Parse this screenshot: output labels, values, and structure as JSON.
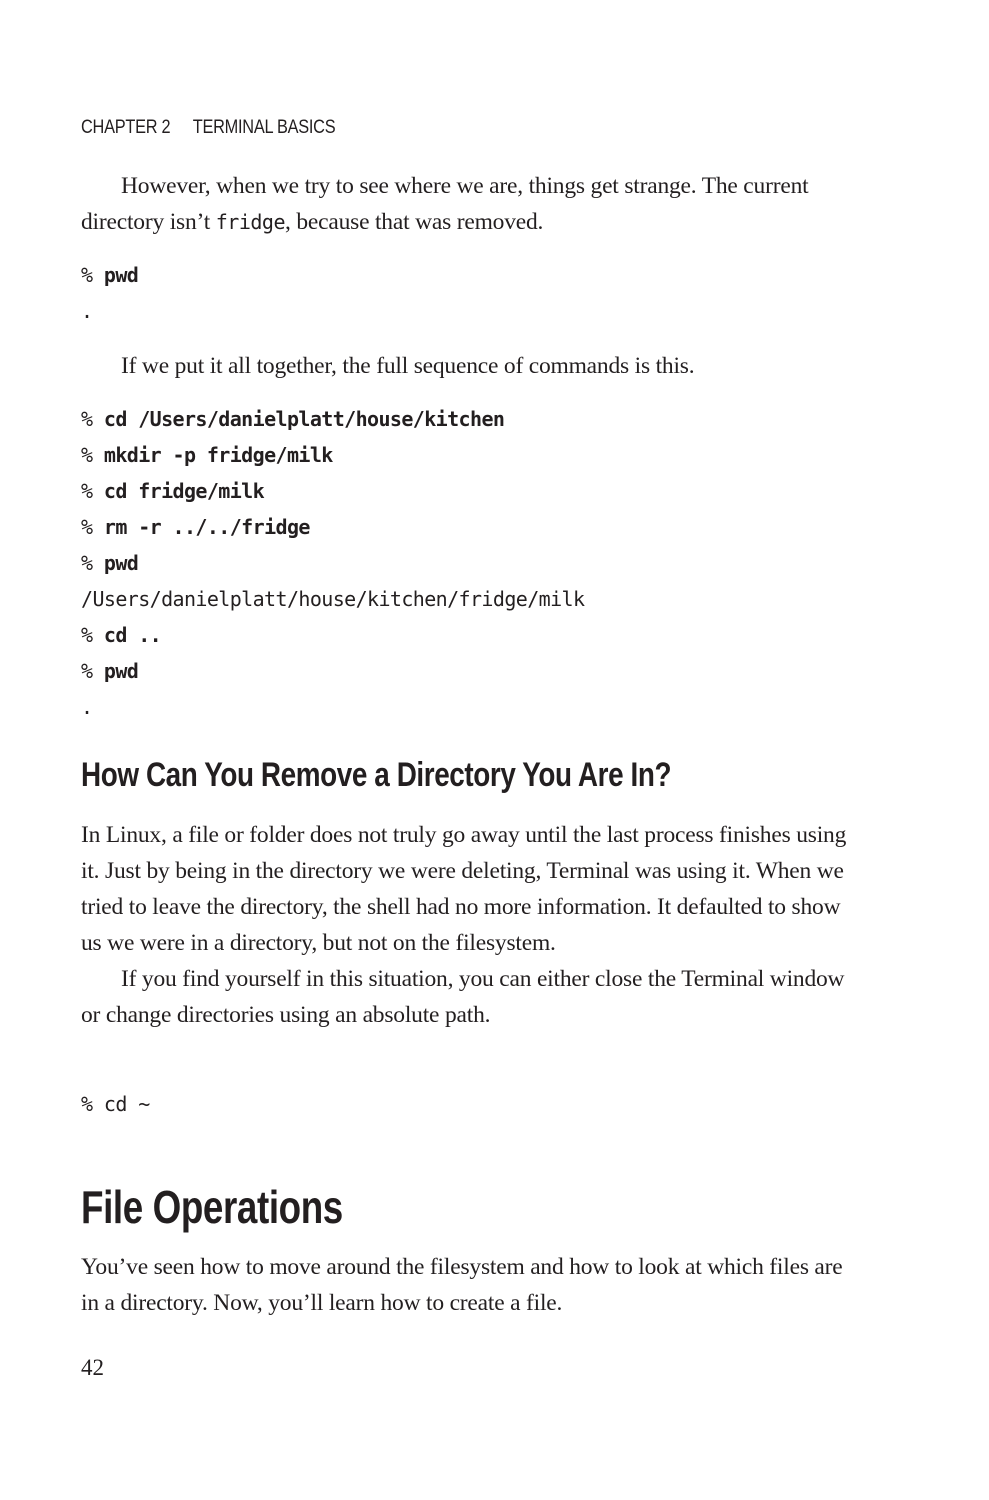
{
  "running_head": {
    "chapter": "CHAPTER 2",
    "title": "TERMINAL BASICS"
  },
  "paragraphs": {
    "p1_before": "However, when we try to see where we are, things get strange. The current directory isn’t ",
    "p1_code": "fridge",
    "p1_after": ", because that was removed.",
    "p2": "If we put it all together, the full sequence of commands is this.",
    "p3": "In Linux, a file or folder does not truly go away until the last process finishes using it. Just by being in the directory we were deleting, Terminal was using it. When we tried to leave the directory, the shell had no more information. It defaulted to show us we were in a directory, but not on the filesystem.",
    "p4": "If you find yourself in this situation, you can either close the Terminal window or change directories using an absolute path.",
    "p5": "You’ve seen how to move around the filesystem and how to look at which files are in a directory. Now, you’ll learn how to create a file."
  },
  "code_block_1": {
    "lines": [
      {
        "prompt": "% ",
        "command": "pwd",
        "output": ""
      },
      {
        "prompt": "",
        "command": "",
        "output": "."
      }
    ]
  },
  "code_block_2": {
    "lines": [
      {
        "prompt": "% ",
        "command": "cd /Users/danielplatt/house/kitchen",
        "output": ""
      },
      {
        "prompt": "% ",
        "command": "mkdir -p fridge/milk",
        "output": ""
      },
      {
        "prompt": "% ",
        "command": "cd fridge/milk",
        "output": ""
      },
      {
        "prompt": "% ",
        "command": "rm -r ../../fridge",
        "output": ""
      },
      {
        "prompt": "% ",
        "command": "pwd",
        "output": ""
      },
      {
        "prompt": "",
        "command": "",
        "output": "/Users/danielplatt/house/kitchen/fridge/milk"
      },
      {
        "prompt": "% ",
        "command": "cd ..",
        "output": ""
      },
      {
        "prompt": "% ",
        "command": "pwd",
        "output": ""
      },
      {
        "prompt": "",
        "command": "",
        "output": "."
      }
    ]
  },
  "code_block_3": {
    "lines": [
      {
        "prompt": "",
        "command": "",
        "output": "% cd ~"
      }
    ]
  },
  "headings": {
    "section": "How Can You Remove a Directory You Are In?",
    "chapter_section": "File Operations"
  },
  "page_number": "42"
}
